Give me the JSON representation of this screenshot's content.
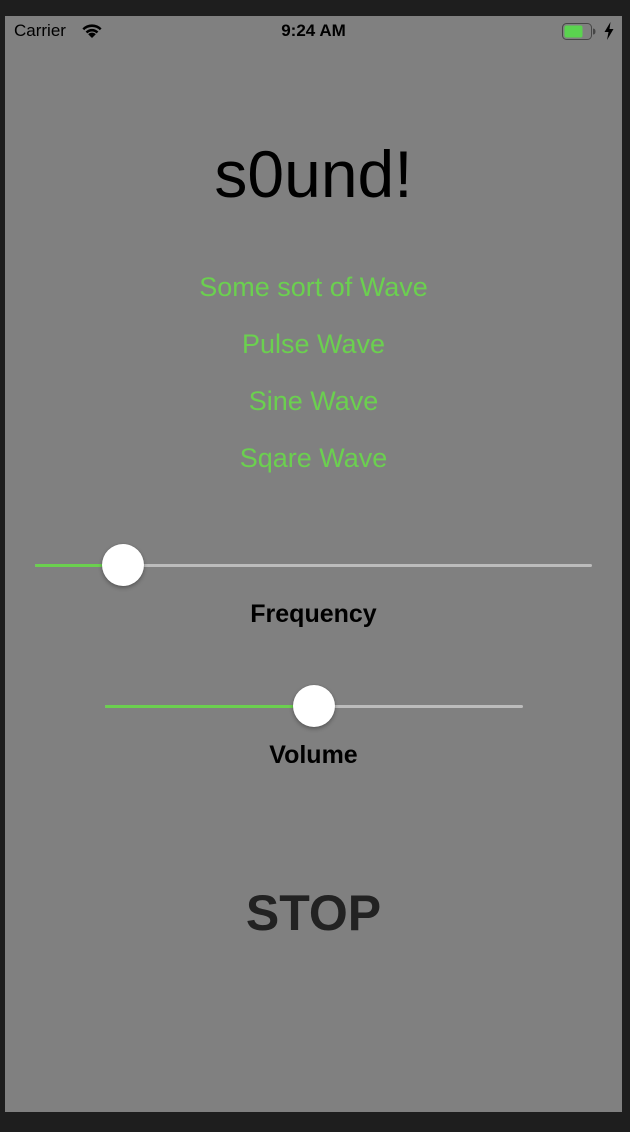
{
  "status_bar": {
    "carrier": "Carrier",
    "time": "9:24 AM",
    "wifi_icon": "wifi-icon",
    "battery_icon": "battery-icon",
    "charging_icon": "charging-bolt-icon"
  },
  "title": "s0und!",
  "waves": [
    {
      "label": "Some sort of Wave"
    },
    {
      "label": "Pulse Wave"
    },
    {
      "label": "Sine Wave"
    },
    {
      "label": "Sqare Wave"
    }
  ],
  "frequency": {
    "label": "Frequency",
    "value": 0.13
  },
  "volume": {
    "label": "Volume",
    "value": 0.5
  },
  "stop_label": "STOP",
  "colors": {
    "accent": "#6bd04f",
    "background": "#808080",
    "track": "#bcbcbc",
    "battery": "#5ad34f"
  }
}
